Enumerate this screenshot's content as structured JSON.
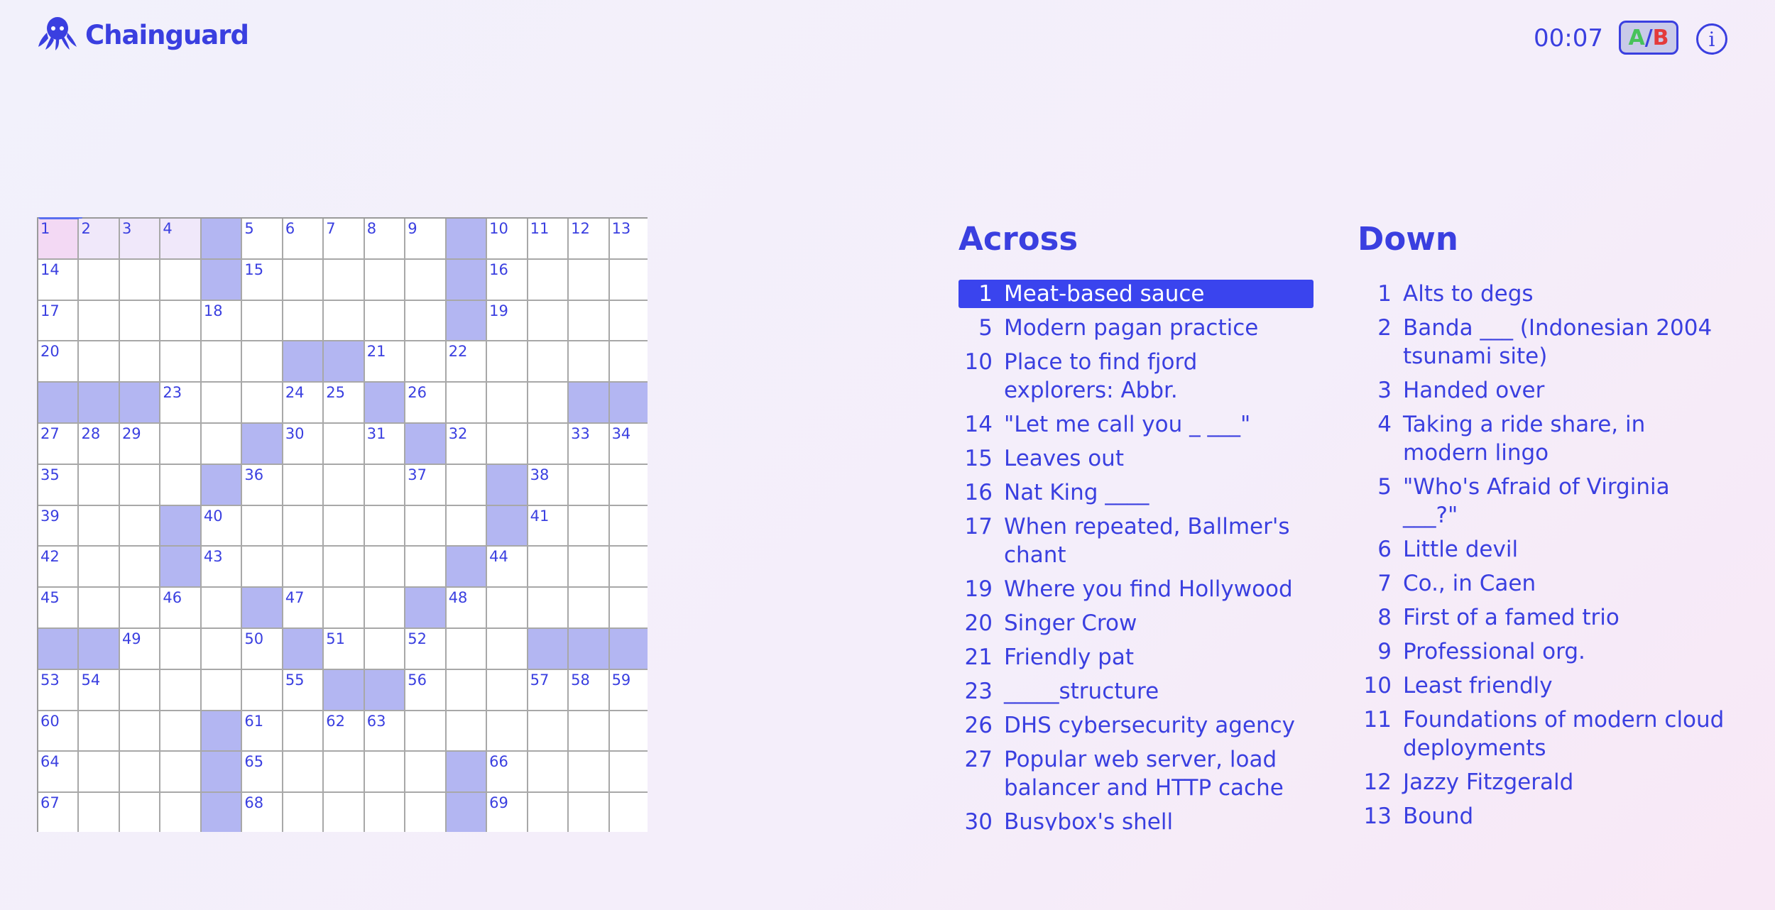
{
  "app": {
    "name": "Chainguard"
  },
  "timer": "00:07",
  "ab_toggle": {
    "a": "A",
    "slash": "/",
    "b": "B"
  },
  "info_label": "i",
  "grid": {
    "rows": [
      [
        "1",
        "2",
        "3",
        "4",
        "#",
        "5",
        "6",
        "7",
        "8",
        "9",
        "#",
        "10",
        "11",
        "12",
        "13"
      ],
      [
        "14",
        "",
        "",
        "",
        "#",
        "15",
        "",
        "",
        "",
        "",
        "#",
        "16",
        "",
        "",
        ""
      ],
      [
        "17",
        "",
        "",
        "",
        "18",
        "",
        "",
        "",
        "",
        "",
        "#",
        "19",
        "",
        "",
        ""
      ],
      [
        "20",
        "",
        "",
        "",
        "",
        "",
        "#",
        "#",
        "21",
        "",
        "22",
        "",
        "",
        "",
        ""
      ],
      [
        "#",
        "#",
        "#",
        "23",
        "",
        "",
        "24",
        "25",
        "#",
        "26",
        "",
        "",
        "",
        "#",
        "#"
      ],
      [
        "27",
        "28",
        "29",
        "",
        "",
        "#",
        "30",
        "",
        "31",
        "#",
        "32",
        "",
        "",
        "33",
        "34"
      ],
      [
        "35",
        "",
        "",
        "",
        "#",
        "36",
        "",
        "",
        "",
        "37",
        "",
        "#",
        "38",
        "",
        ""
      ],
      [
        "39",
        "",
        "",
        "#",
        "40",
        "",
        "",
        "",
        "",
        "",
        "",
        "#",
        "41",
        "",
        ""
      ],
      [
        "42",
        "",
        "",
        "#",
        "43",
        "",
        "",
        "",
        "",
        "",
        "#",
        "44",
        "",
        "",
        ""
      ],
      [
        "45",
        "",
        "",
        "46",
        "",
        "#",
        "47",
        "",
        "",
        "#",
        "48",
        "",
        "",
        "",
        ""
      ],
      [
        "#",
        "#",
        "49",
        "",
        "",
        "50",
        "#",
        "51",
        "",
        "52",
        "",
        "",
        "#",
        "#",
        "#"
      ],
      [
        "53",
        "54",
        "",
        "",
        "",
        "",
        "55",
        "#",
        "#",
        "56",
        "",
        "",
        "57",
        "58",
        "59"
      ],
      [
        "60",
        "",
        "",
        "",
        "#",
        "61",
        "",
        "62",
        "63",
        "",
        "",
        "",
        "",
        "",
        ""
      ],
      [
        "64",
        "",
        "",
        "",
        "#",
        "65",
        "",
        "",
        "",
        "",
        "#",
        "66",
        "",
        "",
        ""
      ],
      [
        "67",
        "",
        "",
        "",
        "#",
        "68",
        "",
        "",
        "",
        "",
        "#",
        "69",
        "",
        "",
        ""
      ]
    ],
    "active_cell": [
      0,
      0
    ],
    "highlighted_word": [
      [
        0,
        0
      ],
      [
        0,
        1
      ],
      [
        0,
        2
      ],
      [
        0,
        3
      ]
    ]
  },
  "across": {
    "title": "Across",
    "clues": [
      {
        "num": "1",
        "text": "Meat-based sauce",
        "selected": true
      },
      {
        "num": "5",
        "text": "Modern pagan practice"
      },
      {
        "num": "10",
        "text": "Place to find fjord explorers: Abbr."
      },
      {
        "num": "14",
        "text": "\"Let me call you _ ___\""
      },
      {
        "num": "15",
        "text": "Leaves out"
      },
      {
        "num": "16",
        "text": "Nat King ____"
      },
      {
        "num": "17",
        "text": "When repeated, Ballmer's chant"
      },
      {
        "num": "19",
        "text": "Where you find Hollywood"
      },
      {
        "num": "20",
        "text": "Singer Crow"
      },
      {
        "num": "21",
        "text": "Friendly pat"
      },
      {
        "num": "23",
        "text": "_____structure"
      },
      {
        "num": "26",
        "text": "DHS cybersecurity agency"
      },
      {
        "num": "27",
        "text": "Popular web server, load balancer and HTTP cache"
      },
      {
        "num": "30",
        "text": "Busybox's shell"
      }
    ]
  },
  "down": {
    "title": "Down",
    "clues": [
      {
        "num": "1",
        "text": "Alts to degs"
      },
      {
        "num": "2",
        "text": "Banda ___ (Indonesian 2004 tsunami site)"
      },
      {
        "num": "3",
        "text": "Handed over"
      },
      {
        "num": "4",
        "text": "Taking a ride share, in modern lingo"
      },
      {
        "num": "5",
        "text": "\"Who's Afraid of Virginia ___?\""
      },
      {
        "num": "6",
        "text": "Little devil"
      },
      {
        "num": "7",
        "text": "Co., in Caen"
      },
      {
        "num": "8",
        "text": "First of a famed trio"
      },
      {
        "num": "9",
        "text": "Professional org."
      },
      {
        "num": "10",
        "text": "Least friendly"
      },
      {
        "num": "11",
        "text": "Foundations of modern cloud deployments"
      },
      {
        "num": "12",
        "text": "Jazzy Fitzgerald"
      },
      {
        "num": "13",
        "text": "Bound"
      }
    ]
  },
  "colors": {
    "accent": "#3a3fe0",
    "block": "#b3b6f2",
    "selected_clue": "#3a44ee",
    "active_cell": "#f3d9f4"
  }
}
